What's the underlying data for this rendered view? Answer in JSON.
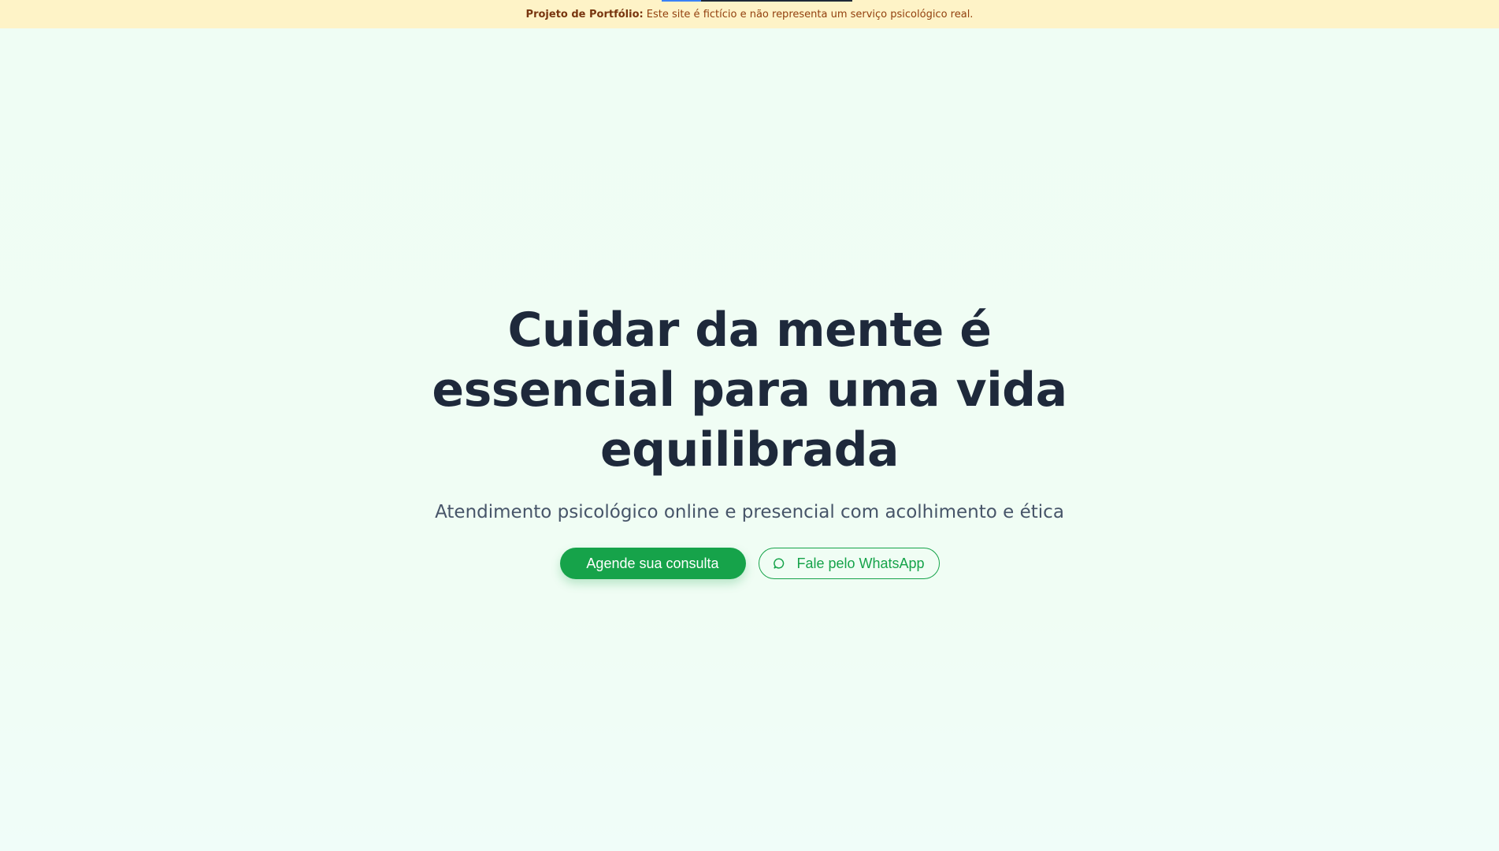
{
  "banner": {
    "label": "Projeto de Portfólio:",
    "text": "Este site é fictício e não representa um serviço psicológico real."
  },
  "hero": {
    "title": "Cuidar da mente é essencial para uma vida equilibrada",
    "subtitle": "Atendimento psicológico online e presencial com acolhimento e ética",
    "primary_button": "Agende sua consulta",
    "secondary_button": "Fale pelo WhatsApp",
    "secondary_icon": "whatsapp-icon"
  },
  "colors": {
    "accent": "#16a34a",
    "banner_bg": "#fef3c7",
    "page_bg": "#f0fdf4",
    "title": "#1e293b",
    "subtitle": "#475569"
  }
}
